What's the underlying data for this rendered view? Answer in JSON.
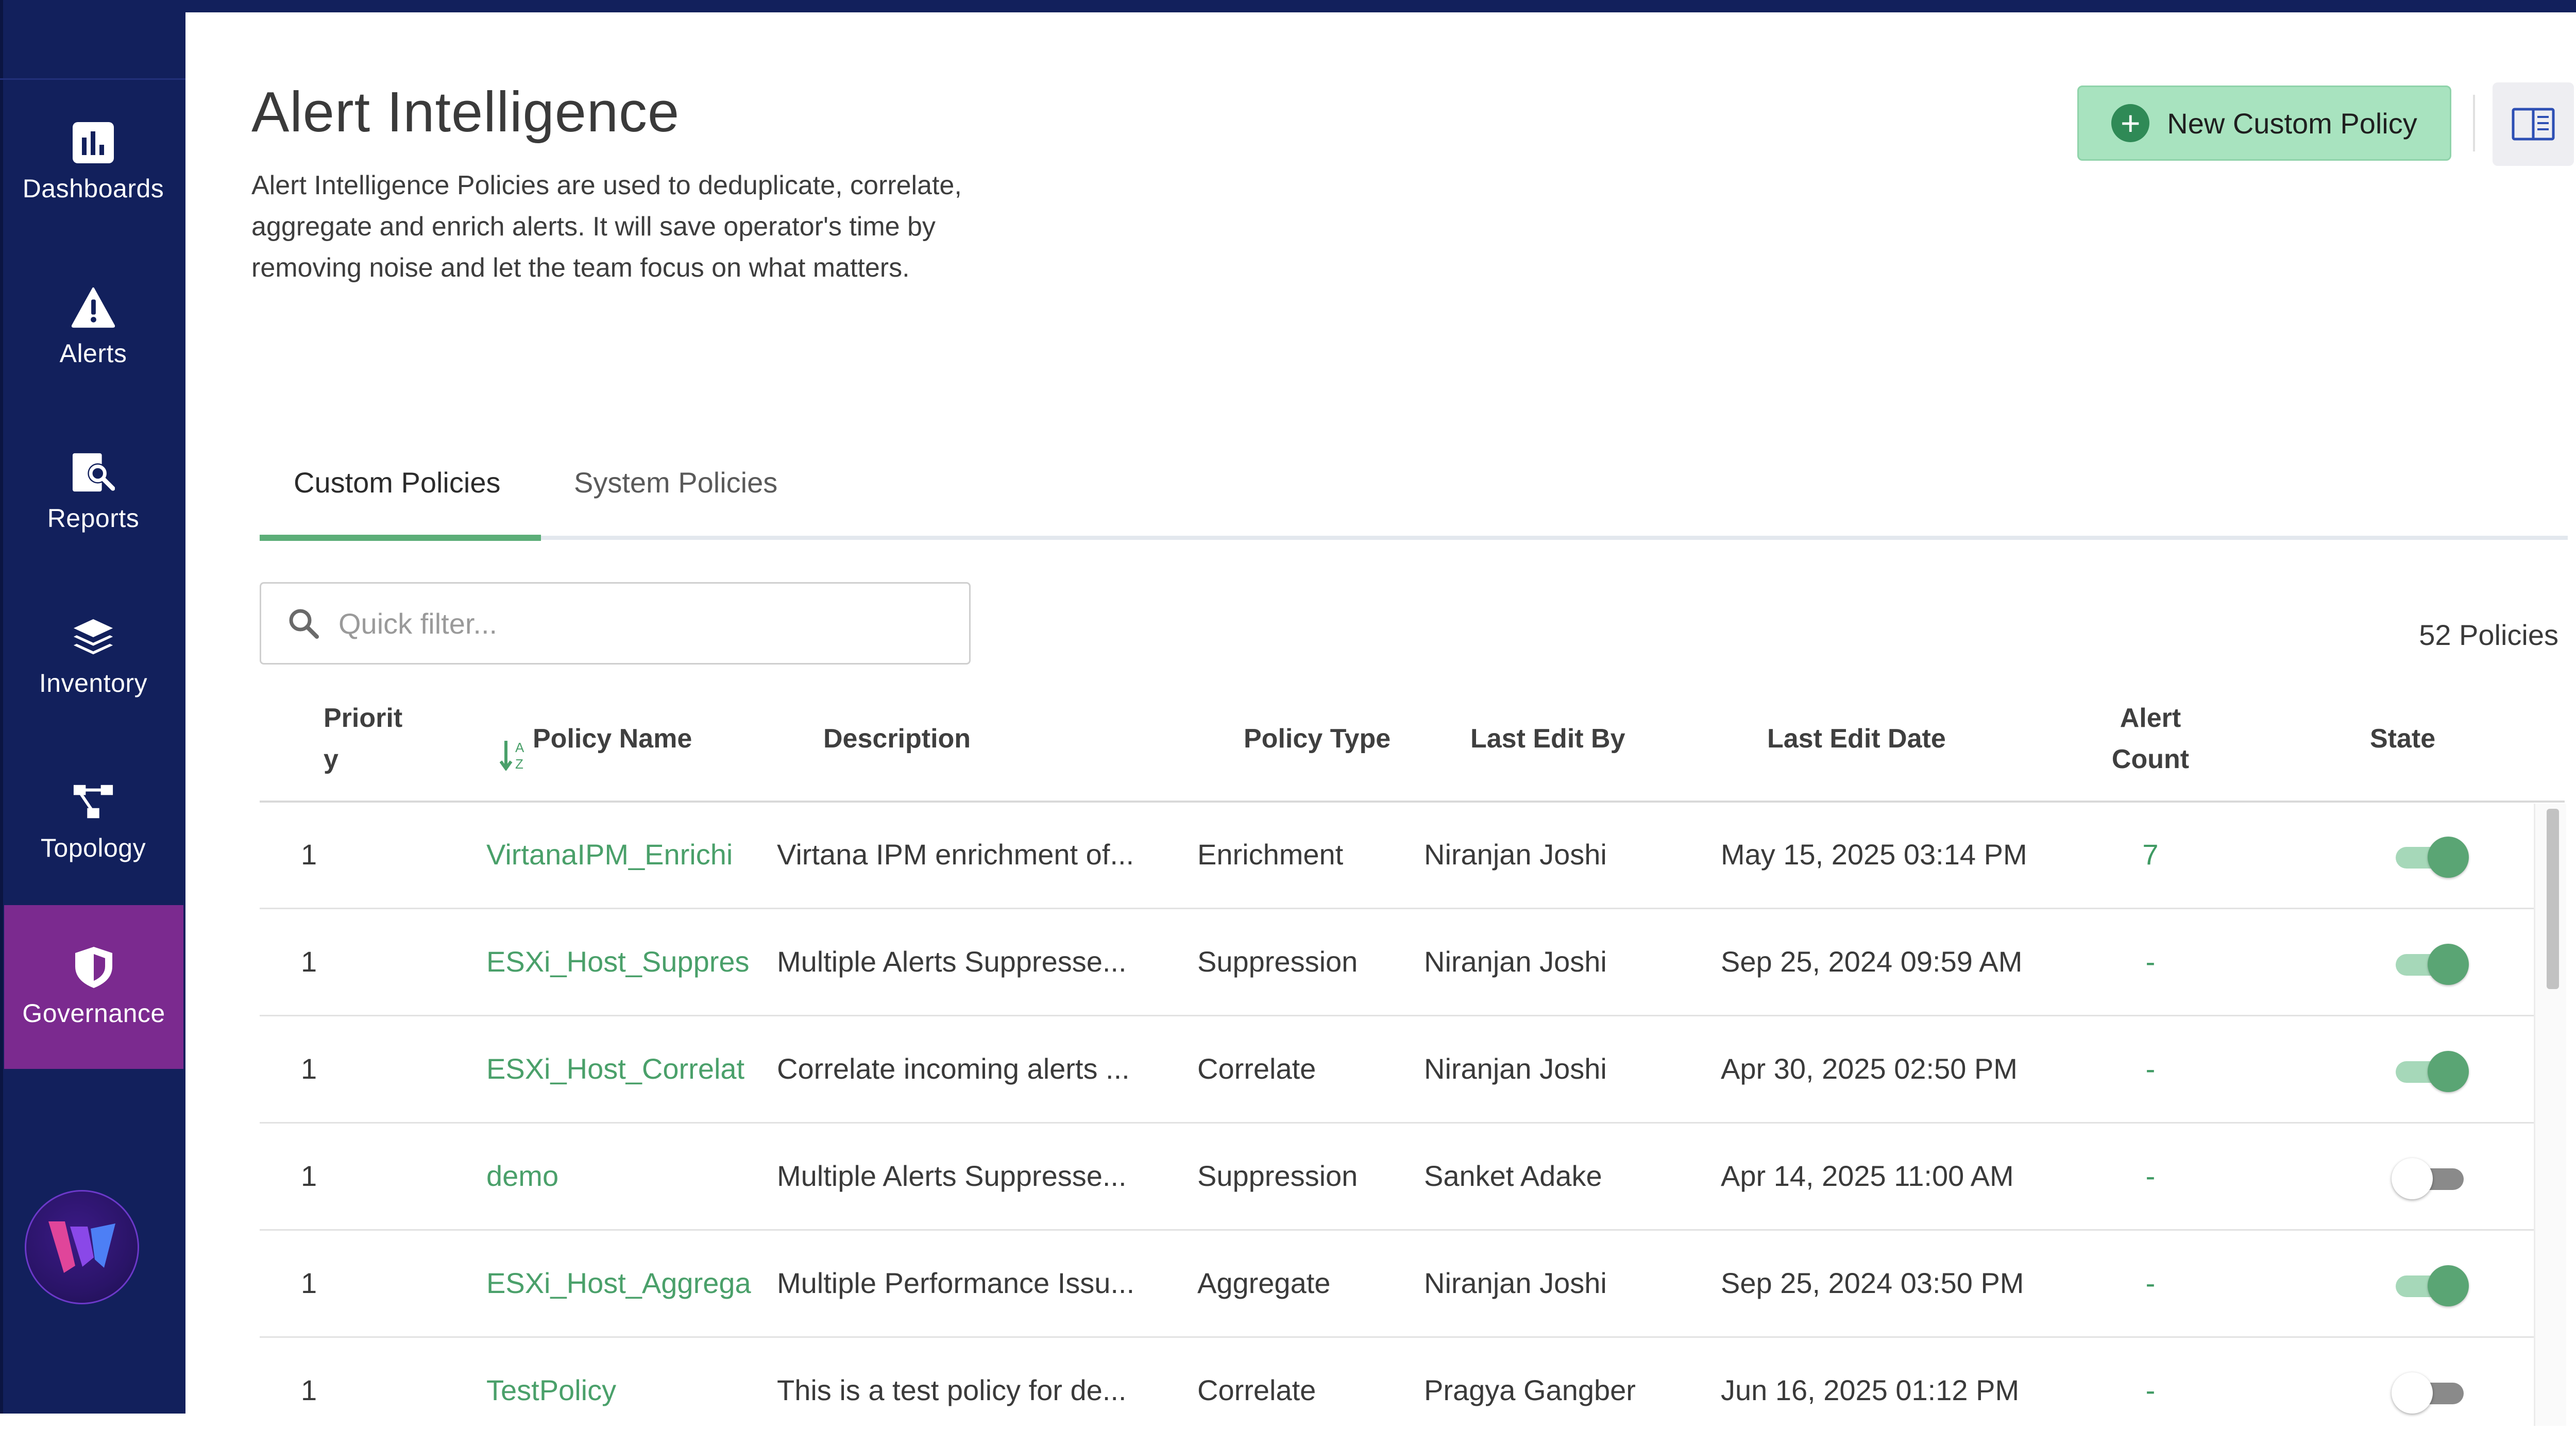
{
  "sidebar": {
    "items": [
      {
        "label": "Dashboards",
        "icon": "bar-chart-icon"
      },
      {
        "label": "Alerts",
        "icon": "warning-triangle-icon"
      },
      {
        "label": "Reports",
        "icon": "report-search-icon"
      },
      {
        "label": "Inventory",
        "icon": "layers-icon"
      },
      {
        "label": "Topology",
        "icon": "topology-icon"
      },
      {
        "label": "Governance",
        "icon": "shield-icon"
      }
    ],
    "active": "Governance",
    "logo": "virtana-logo"
  },
  "header": {
    "title": "Alert Intelligence",
    "description": "Alert Intelligence Policies are used to deduplicate, correlate, aggregate and enrich alerts. It will save operator's time by removing noise and let the team focus on what matters.",
    "new_button_label": "New Custom Policy",
    "book_icon": "book-open-icon"
  },
  "tabs": [
    {
      "label": "Custom Policies",
      "active": true
    },
    {
      "label": "System Policies",
      "active": false
    }
  ],
  "filter": {
    "placeholder": "Quick filter...",
    "value": ""
  },
  "policy_count": "52 Policies",
  "table": {
    "columns": {
      "priority": "Priorit\ny",
      "name": "Policy Name",
      "description": "Description",
      "type": "Policy Type",
      "edit_by": "Last Edit By",
      "edit_date": "Last Edit Date",
      "alert_count": "Alert\nCount",
      "state": "State"
    },
    "rows": [
      {
        "priority": "1",
        "name": "VirtanaIPM_Enrichi",
        "description": "Virtana IPM enrichment of...",
        "type": "Enrichment",
        "edit_by": "Niranjan Joshi",
        "edit_date": "May 15, 2025 03:14 PM",
        "alert_count": "7",
        "state": true
      },
      {
        "priority": "1",
        "name": "ESXi_Host_Suppres",
        "description": "Multiple Alerts Suppresse...",
        "type": "Suppression",
        "edit_by": "Niranjan Joshi",
        "edit_date": "Sep 25, 2024 09:59 AM",
        "alert_count": "-",
        "state": true
      },
      {
        "priority": "1",
        "name": "ESXi_Host_Correlat",
        "description": "Correlate incoming alerts ...",
        "type": "Correlate",
        "edit_by": "Niranjan Joshi",
        "edit_date": "Apr 30, 2025 02:50 PM",
        "alert_count": "-",
        "state": true
      },
      {
        "priority": "1",
        "name": "demo",
        "description": "Multiple Alerts Suppresse...",
        "type": "Suppression",
        "edit_by": "Sanket Adake",
        "edit_date": "Apr 14, 2025 11:00 AM",
        "alert_count": "-",
        "state": false
      },
      {
        "priority": "1",
        "name": "ESXi_Host_Aggrega",
        "description": "Multiple Performance Issu...",
        "type": "Aggregate",
        "edit_by": "Niranjan Joshi",
        "edit_date": "Sep 25, 2024 03:50 PM",
        "alert_count": "-",
        "state": true
      },
      {
        "priority": "1",
        "name": "TestPolicy",
        "description": "This is a test policy for de...",
        "type": "Correlate",
        "edit_by": "Pragya Gangber",
        "edit_date": "Jun 16, 2025 01:12 PM",
        "alert_count": "-",
        "state": false
      }
    ]
  },
  "colors": {
    "sidebar_bg": "#12205c",
    "active_nav_bg": "#7b2a8f",
    "accent_green": "#5cae78",
    "button_green_bg": "#a8e3bf"
  }
}
